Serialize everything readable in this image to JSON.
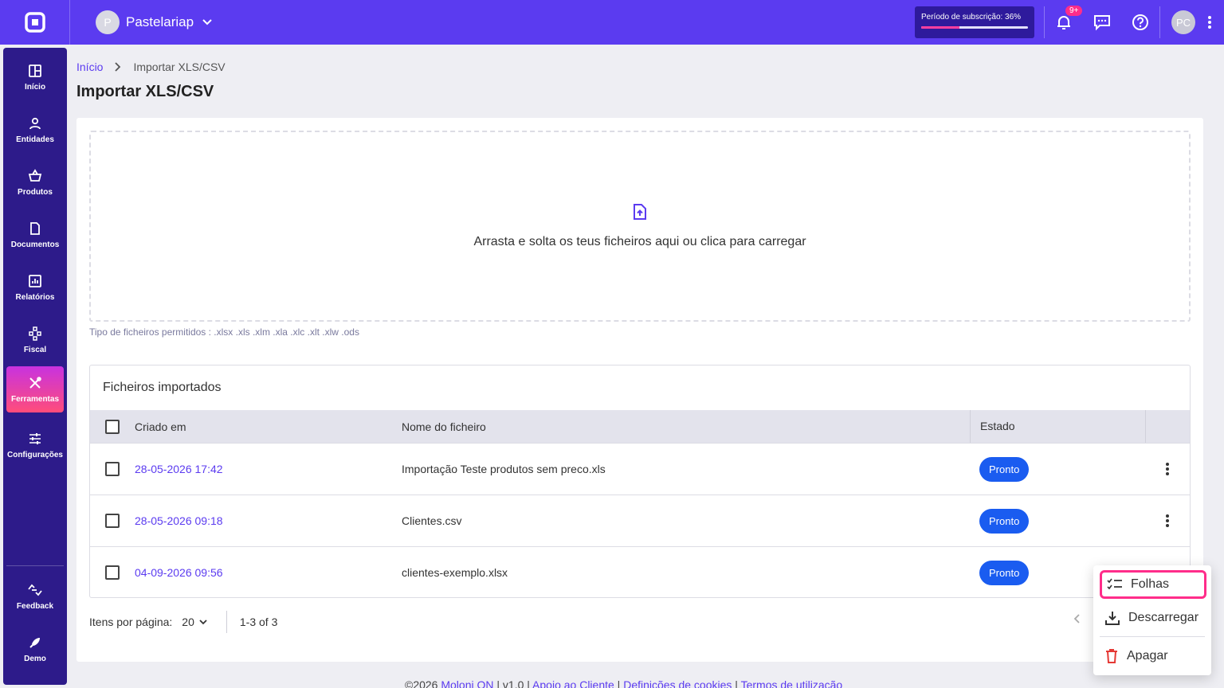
{
  "topbar": {
    "company_initial": "P",
    "company_name": "Pastelariap",
    "subscription_label": "Período de subscrição: 36%",
    "subscription_progress": 0.36,
    "notifications_badge": "9+",
    "user_initials": "PC"
  },
  "sidebar": {
    "items": [
      {
        "label": "Início",
        "icon": "grid-icon"
      },
      {
        "label": "Entidades",
        "icon": "person-icon"
      },
      {
        "label": "Produtos",
        "icon": "basket-icon"
      },
      {
        "label": "Documentos",
        "icon": "document-icon"
      },
      {
        "label": "Relatórios",
        "icon": "chart-icon"
      },
      {
        "label": "Fiscal",
        "icon": "hierarchy-icon"
      },
      {
        "label": "Ferramentas",
        "icon": "tools-icon",
        "active": true
      },
      {
        "label": "Configurações",
        "icon": "sliders-icon"
      }
    ],
    "bottom": [
      {
        "label": "Feedback",
        "icon": "feedback-icon"
      },
      {
        "label": "Demo",
        "icon": "rocket-icon"
      }
    ]
  },
  "breadcrumb": {
    "home": "Início",
    "current": "Importar XLS/CSV"
  },
  "page_title": "Importar XLS/CSV",
  "dropzone": {
    "text": "Arrasta e solta os teus ficheiros aqui ou clica para carregar",
    "allowed": "Tipo de ficheiros permitidos : .xlsx .xls .xlm .xla .xlc .xlt .xlw .ods"
  },
  "imported": {
    "title": "Ficheiros importados",
    "columns": {
      "created": "Criado em",
      "name": "Nome do ficheiro",
      "state": "Estado"
    },
    "rows": [
      {
        "created": "28-05-2026 17:42",
        "name": "Importação Teste produtos sem preco.xls",
        "state": "Pronto"
      },
      {
        "created": "28-05-2026 09:18",
        "name": "Clientes.csv",
        "state": "Pronto"
      },
      {
        "created": "04-09-2026 09:56",
        "name": "clientes-exemplo.xlsx",
        "state": "Pronto"
      }
    ]
  },
  "pager": {
    "label": "Itens por página:",
    "per_page": "20",
    "range": "1-3 of 3"
  },
  "footer": {
    "copyright": "©2026",
    "brand": "Moloni ON",
    "version": "v1.0",
    "support": "Apoio ao Cliente",
    "cookies": "Definições de cookies",
    "terms": "Termos de utilização"
  },
  "context_menu": {
    "sheets": "Folhas",
    "download": "Descarregar",
    "delete": "Apagar"
  },
  "colors": {
    "primary": "#5b3bf0",
    "sidebar": "#2d1b8a",
    "pill": "#1a5cf0",
    "highlight": "#ff2d8a",
    "danger": "#e53935"
  }
}
